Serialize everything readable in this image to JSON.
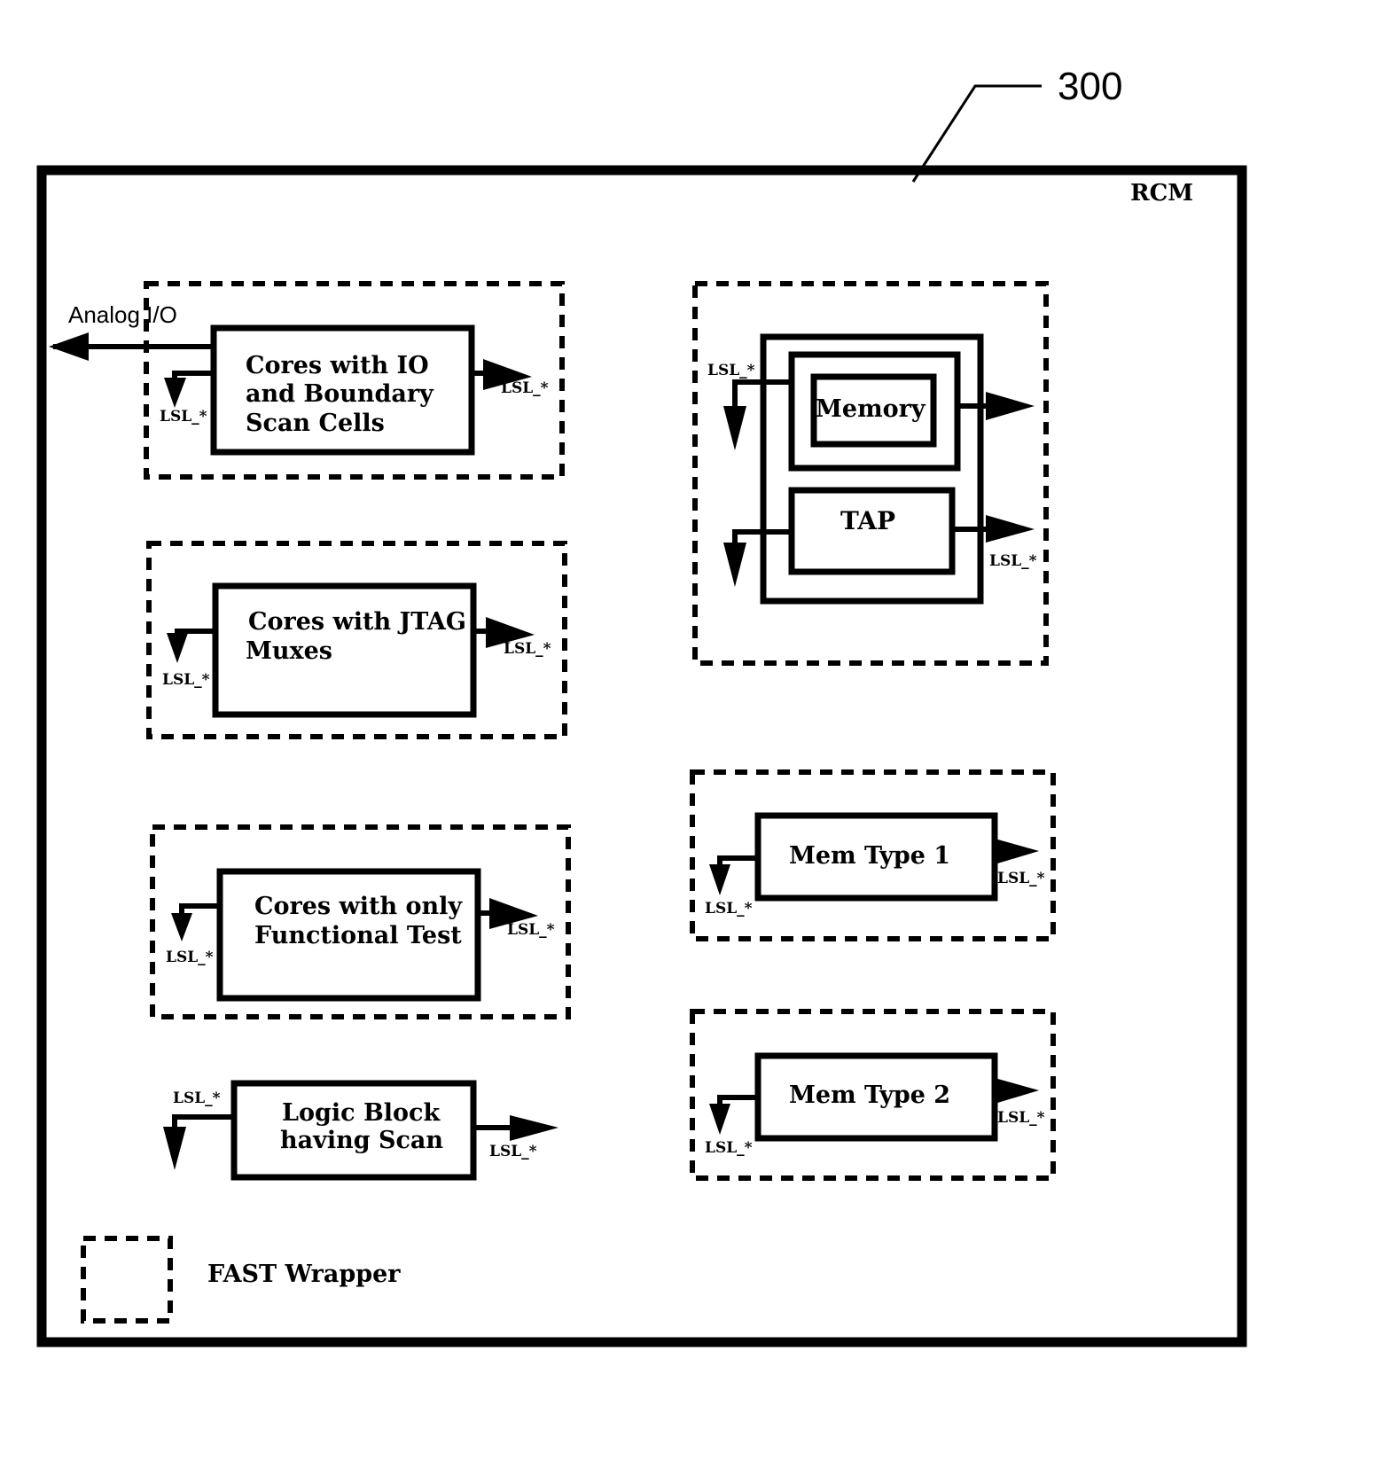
{
  "figure": {
    "reference_number": "300",
    "container_label": "RCM"
  },
  "signals": {
    "analog_io": "Analog I/O",
    "lsl": "LSL_*"
  },
  "blocks": [
    {
      "id": "io-boundary",
      "lines": [
        "Cores with IO",
        "and Boundary",
        "Scan Cells"
      ],
      "wrapped": true
    },
    {
      "id": "jtag-muxes",
      "lines": [
        "Cores with JTAG",
        "Muxes"
      ],
      "wrapped": true
    },
    {
      "id": "functional-test",
      "lines": [
        "Cores with only",
        "Functional Test"
      ],
      "wrapped": true
    },
    {
      "id": "logic-block",
      "lines": [
        "Logic Block",
        "having Scan"
      ],
      "wrapped": false
    },
    {
      "id": "memory",
      "lines": [
        "Memory"
      ],
      "wrapped": true
    },
    {
      "id": "tap",
      "lines": [
        "TAP"
      ],
      "wrapped": true
    },
    {
      "id": "mem-type-1",
      "lines": [
        "Mem Type 1"
      ],
      "wrapped": true
    },
    {
      "id": "mem-type-2",
      "lines": [
        "Mem Type 2"
      ],
      "wrapped": true
    }
  ],
  "legend": {
    "fast_wrapper_label": "FAST Wrapper"
  }
}
